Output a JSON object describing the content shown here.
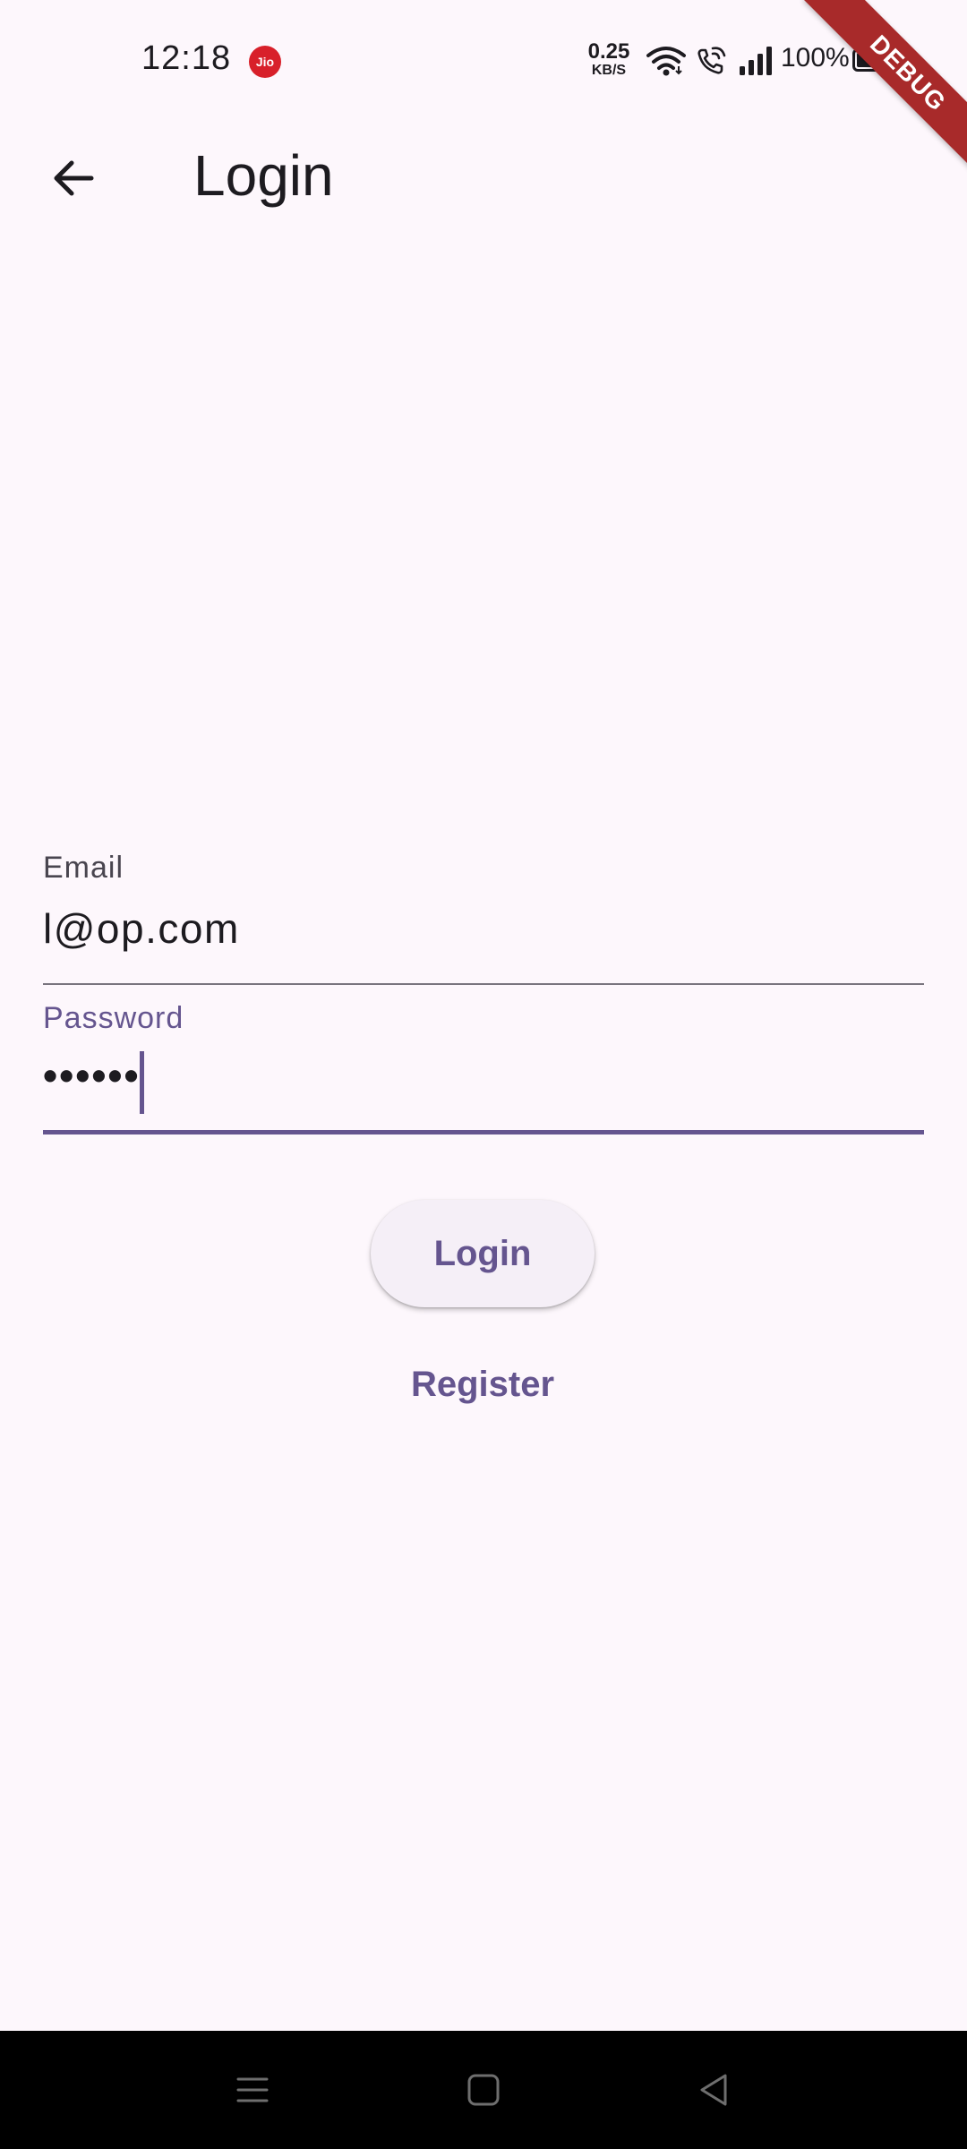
{
  "status_bar": {
    "time": "12:18",
    "carrier_badge": "Jio",
    "network_speed_value": "0.25",
    "network_speed_unit": "KB/S",
    "battery_percent": "100%"
  },
  "debug_banner": "DEBUG",
  "app_bar": {
    "title": "Login"
  },
  "form": {
    "email_label": "Email",
    "email_value": "l@op.com",
    "password_label": "Password",
    "password_value": "••••••"
  },
  "actions": {
    "login_label": "Login",
    "register_label": "Register"
  },
  "colors": {
    "background": "#fdf7fc",
    "primary": "#65558f",
    "on_surface": "#1d1b20",
    "debug_ribbon": "#a82a2a",
    "carrier_badge": "#d8202a"
  }
}
